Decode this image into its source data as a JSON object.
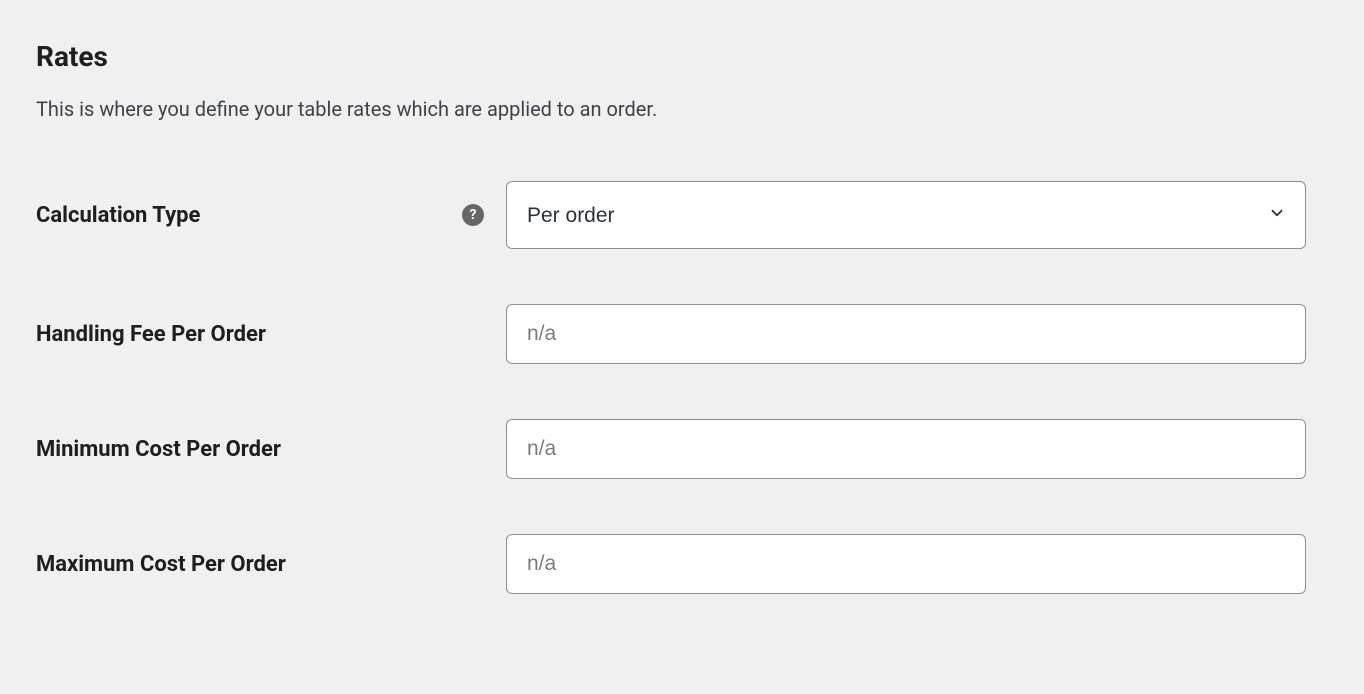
{
  "section": {
    "title": "Rates",
    "description": "This is where you define your table rates which are applied to an order."
  },
  "fields": {
    "calculation_type": {
      "label": "Calculation Type",
      "value": "Per order",
      "help": "?"
    },
    "handling_fee": {
      "label": "Handling Fee Per Order",
      "placeholder": "n/a",
      "value": ""
    },
    "min_cost": {
      "label": "Minimum Cost Per Order",
      "placeholder": "n/a",
      "value": ""
    },
    "max_cost": {
      "label": "Maximum Cost Per Order",
      "placeholder": "n/a",
      "value": ""
    }
  }
}
